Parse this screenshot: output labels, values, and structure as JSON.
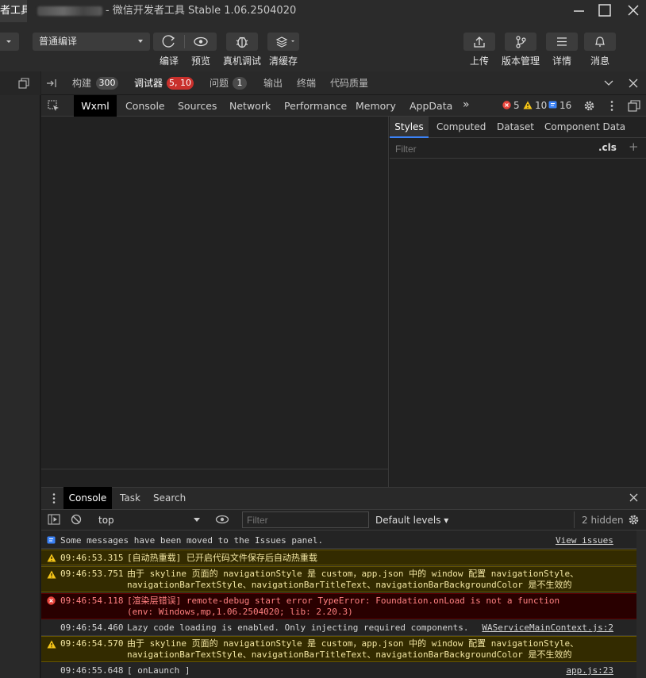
{
  "window": {
    "app_tab": "者工具",
    "title": "- 微信开发者工具 Stable 1.06.2504020"
  },
  "toolbar": {
    "compile_mode": "普通编译",
    "buttons": {
      "compile": "编译",
      "preview": "预览",
      "remote_debug": "真机调试",
      "clear_cache": "清缓存"
    },
    "right_buttons": {
      "upload": "上传",
      "version": "版本管理",
      "details": "详情",
      "messages": "消息"
    }
  },
  "devtools": {
    "outer_tabs": {
      "build": "构建",
      "build_count": "300",
      "debugger": "调试器",
      "debugger_badge": "5, 10",
      "issues": "问题",
      "issues_count": "1",
      "output": "输出",
      "terminal": "终端",
      "code_quality": "代码质量"
    },
    "inner_tabs": {
      "wxml": "Wxml",
      "console": "Console",
      "sources": "Sources",
      "network": "Network",
      "performance": "Performance",
      "memory": "Memory",
      "appdata": "AppData",
      "more": "»"
    },
    "counts": {
      "errors": "5",
      "warnings": "10",
      "infos": "16"
    },
    "styles_tabs": {
      "styles": "Styles",
      "computed": "Computed",
      "dataset": "Dataset",
      "component_data": "Component Data"
    },
    "styles_filter_placeholder": "Filter",
    "cls_label": ".cls",
    "add_label": "+"
  },
  "drawer": {
    "tabs": {
      "console": "Console",
      "task": "Task",
      "search": "Search"
    },
    "context": "top",
    "filter_placeholder": "Filter",
    "levels": "Default levels ▾",
    "hidden": "2 hidden"
  },
  "console": {
    "messages": [
      {
        "level": "info",
        "text": "Some messages have been moved to the Issues panel.",
        "link": "View issues"
      },
      {
        "level": "warn",
        "time": "09:46:53.315",
        "text": "[自动热重载] 已开启代码文件保存后自动热重载"
      },
      {
        "level": "warn",
        "time": "09:46:53.751",
        "text": "由于 skyline 页面的 navigationStyle 是 custom，app.json 中的 window 配置 navigationStyle、",
        "text2": "navigationBarTextStyle、navigationBarTitleText、navigationBarBackgroundColor 是不生效的"
      },
      {
        "level": "error",
        "time": "09:46:54.118",
        "text": "[渲染层错误] remote-debug start error TypeError: Foundation.onLoad is not a function",
        "text2": "(env: Windows,mp,1.06.2504020; lib: 2.20.3)"
      },
      {
        "level": "log",
        "time": "09:46:54.460",
        "text": "Lazy code loading is enabled. Only injecting required components.",
        "source": "WAServiceMainContext.js:2"
      },
      {
        "level": "warn",
        "time": "09:46:54.570",
        "text": "由于 skyline 页面的 navigationStyle 是 custom，app.json 中的 window 配置 navigationStyle、",
        "text2": "navigationBarTextStyle、navigationBarTitleText、navigationBarBackgroundColor 是不生效的"
      },
      {
        "level": "log",
        "time": "09:46:55.648",
        "text": "[ onLaunch ]",
        "source": "app.js:23"
      }
    ]
  },
  "colors": {
    "error": "#e8453c",
    "warning": "#f5c518",
    "info": "#3b82f6"
  }
}
